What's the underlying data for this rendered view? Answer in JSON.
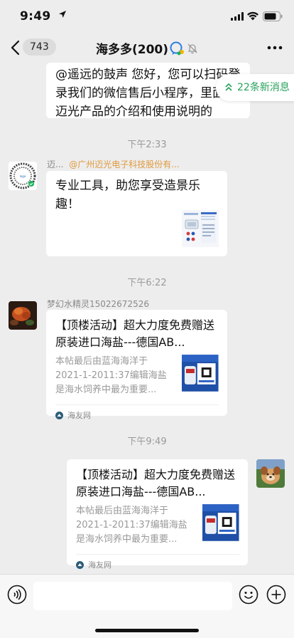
{
  "status_bar": {
    "time": "9:49"
  },
  "nav": {
    "back_count": "743",
    "title": "海多多(200)"
  },
  "new_messages": {
    "label": "22条新消息"
  },
  "messages": {
    "m1": {
      "text": "@遥远的鼓声 您好，您可以扫码登录我们的微信售后小程序，里面有迈光产品的介绍和使用说明的"
    },
    "time1": "下午2:33",
    "m2": {
      "sender": "迈...",
      "sender_group": "@广州迈光电子科技股份有...",
      "text": "专业工具，助您享受造景乐趣！"
    },
    "time2": "下午6:22",
    "m3": {
      "sender": "梦幻水精灵15022672526",
      "title": "【顶楼活动】超大力度免费赠送原装进口海盐---德国AB...",
      "desc": "本帖最后由蓝海海洋于 2021-1-2011:37编辑海盐是海水饲养中最为重要...",
      "source": "海友网"
    },
    "time3": "下午9:49",
    "m4": {
      "title": "【顶楼活动】超大力度免费赠送原装进口海盐---德国AB...",
      "desc": "本帖最后由蓝海海洋于 2021-1-2011:37编辑海盐是海水饲养中最为重要...",
      "source": "海友网"
    }
  },
  "input_bar": {
    "placeholder": ""
  },
  "colors": {
    "background": "#ededed",
    "accent_green": "#27a25c",
    "group_name_orange": "#e09a3e"
  },
  "icons": [
    "back-chevron-icon",
    "qr-code-avatar",
    "chat-badge-icon",
    "mute-bell-icon",
    "more-icon",
    "voice-icon",
    "emoji-icon",
    "plus-icon",
    "double-chevron-up-icon"
  ]
}
